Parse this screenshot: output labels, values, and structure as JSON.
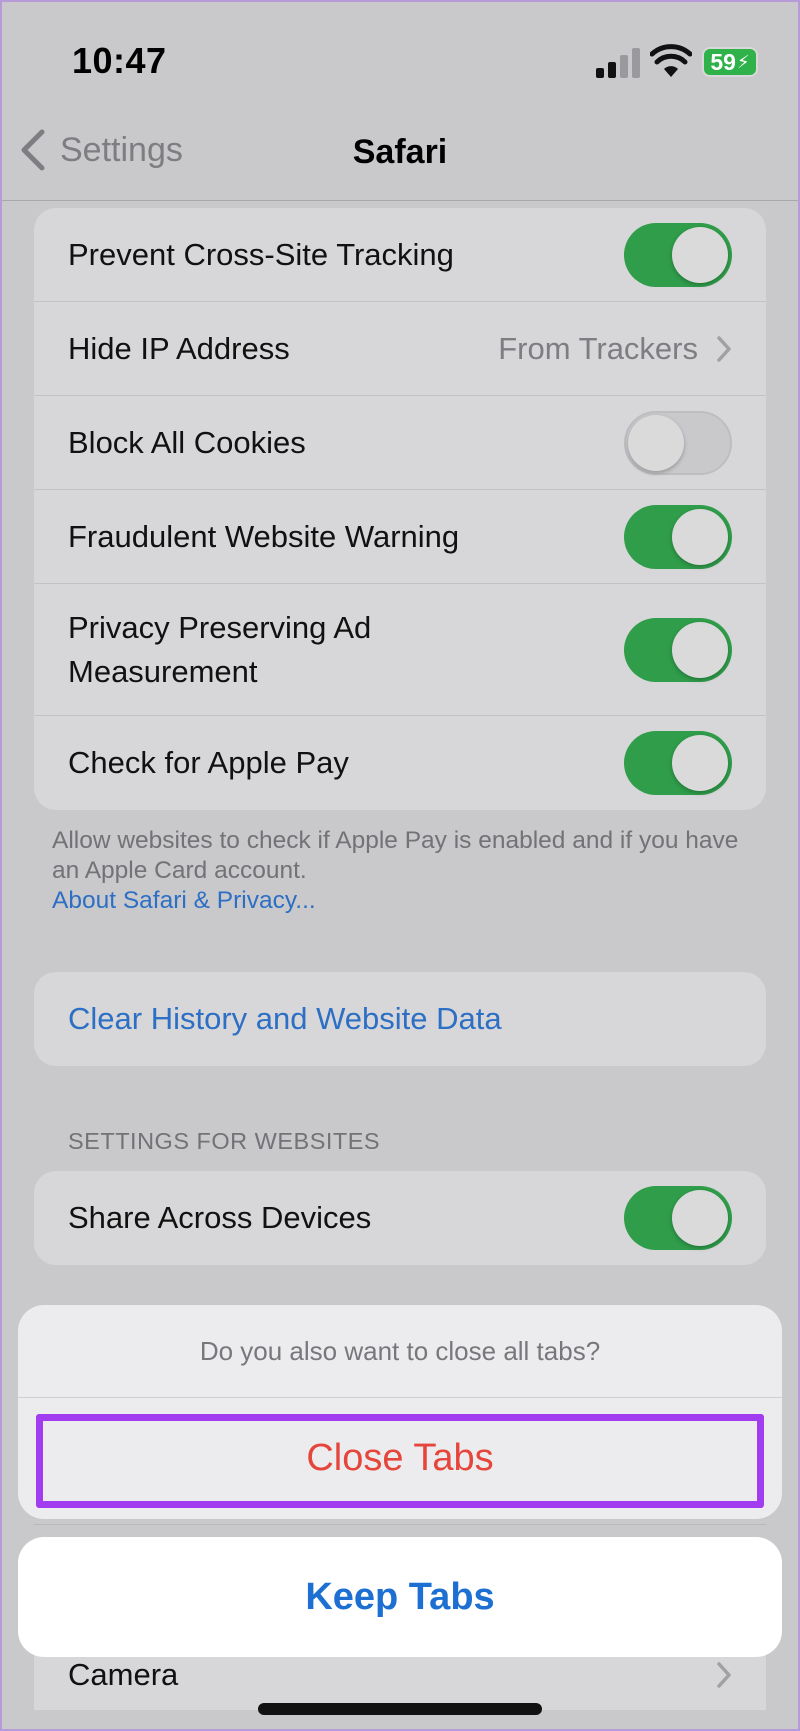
{
  "status_bar": {
    "time": "10:47",
    "battery": "59"
  },
  "nav": {
    "back_label": "Settings",
    "title": "Safari"
  },
  "privacy_group": {
    "rows": [
      {
        "label": "Prevent Cross-Site Tracking",
        "toggle": "on"
      },
      {
        "label": "Hide IP Address",
        "value": "From Trackers"
      },
      {
        "label": "Block All Cookies",
        "toggle": "off"
      },
      {
        "label": "Fraudulent Website Warning",
        "toggle": "on"
      },
      {
        "label": "Privacy Preserving Ad Measurement",
        "toggle": "on"
      },
      {
        "label": "Check for Apple Pay",
        "toggle": "on"
      }
    ],
    "footer": "Allow websites to check if Apple Pay is enabled and if you have an Apple Card account.",
    "footer_link": "About Safari & Privacy..."
  },
  "clear_history": {
    "label": "Clear History and Website Data"
  },
  "websites_section": {
    "header": "SETTINGS FOR WEBSITES",
    "share_across_devices": {
      "label": "Share Across Devices",
      "toggle": "on"
    },
    "camera": {
      "label": "Camera"
    }
  },
  "action_sheet": {
    "message": "Do you also want to close all tabs?",
    "destructive_label": "Close Tabs",
    "cancel_label": "Keep Tabs"
  },
  "colors": {
    "toggle_on": "#2f9d4a",
    "link_blue": "#2c6fc4",
    "destructive_red": "#e5453a",
    "highlight": "#a23cf0"
  }
}
